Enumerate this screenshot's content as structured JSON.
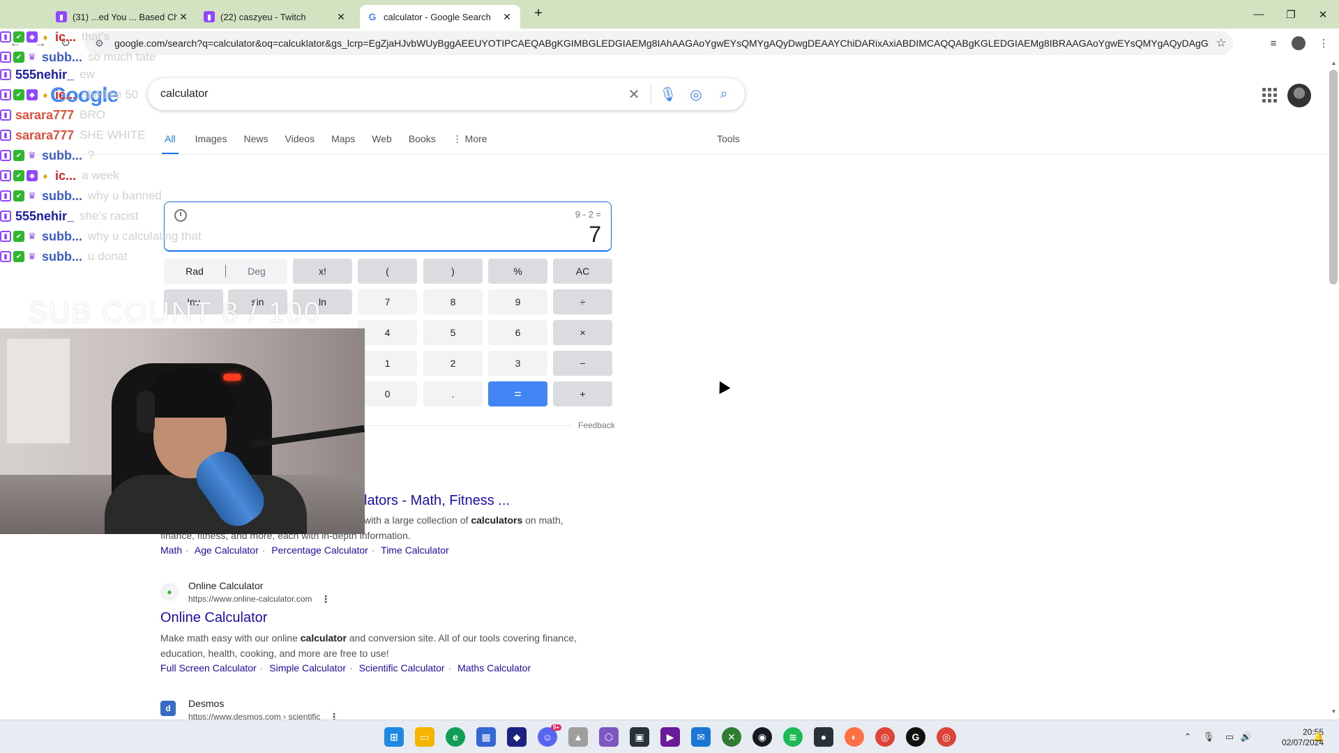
{
  "browser": {
    "tabs": [
      {
        "title": "(31) ...ed You ... Based Ch",
        "favicon": "twitch"
      },
      {
        "title": "(22) caszyeu - Twitch",
        "favicon": "twitch"
      },
      {
        "title": "calculator - Google Search",
        "favicon": "google",
        "active": true
      }
    ],
    "url": "google.com/search?q=calculator&oq=calcuklator&gs_lcrp=EgZjaHJvbWUyBggAEEUYOTIPCAEQABgKGIMBGLEDGIAEMg8IAhAAGAoYgwEYsQMYgAQyDwgDEAAYChiDARixAxiABDIMCAQQABgKGLEDGIAEMg8IBRAAGAoYgwEYsQMYgAQyDAgGEAAYChixAxiAB..."
  },
  "google": {
    "logo": "Google",
    "query": "calculator",
    "tabs": [
      "All",
      "Images",
      "News",
      "Videos",
      "Maps",
      "Web",
      "Books",
      "More"
    ],
    "tools": "Tools"
  },
  "calculator": {
    "expression": "9 - 2 =",
    "result": "7",
    "rad": "Rad",
    "deg": "Deg",
    "keys": {
      "fact": "x!",
      "lparen": "(",
      "rparen": ")",
      "percent": "%",
      "ac": "AC",
      "inv": "Inv",
      "sin": "sin",
      "ln": "ln",
      "k7": "7",
      "k8": "8",
      "k9": "9",
      "div": "÷",
      "k4": "4",
      "k5": "5",
      "k6": "6",
      "mul": "×",
      "k1": "1",
      "k2": "2",
      "k3": "3",
      "sub": "−",
      "k0": "0",
      "dot": ".",
      "eq": "=",
      "add": "+"
    },
    "feedback": "Feedback"
  },
  "results": [
    {
      "title_visible": "lators - Math, Fitness ...",
      "snippet_visible_a": "with a large collection of ",
      "snippet_bold": "calculators",
      "snippet_visible_b": " on math,",
      "snippet_line2": "finance, fitness, and more, each with in-depth information.",
      "sitelinks": [
        "Math",
        "Age Calculator",
        "Percentage Calculator",
        "Time Calculator"
      ]
    },
    {
      "site": "Online Calculator",
      "url": "https://www.online-calculator.com",
      "title": "Online Calculator",
      "snippet_a": "Make math easy with our online ",
      "snippet_bold": "calculator",
      "snippet_b": " and conversion site. All of our tools covering finance,",
      "snippet_line2": "education, health, cooking, and more are free to use!",
      "sitelinks": [
        "Full Screen Calculator",
        "Simple Calculator",
        "Scientific Calculator",
        "Maths Calculator"
      ]
    },
    {
      "site": "Desmos",
      "url": "https://www.desmos.com › scientific"
    }
  ],
  "overlay": {
    "chat": [
      {
        "user": "ic...",
        "color": "#d62222",
        "msg": "that's",
        "badges": [
          "tw",
          "sub",
          "vip",
          "cheer"
        ]
      },
      {
        "user": "subb...",
        "color": "#3c5bc7",
        "msg": "so much tate",
        "badges": [
          "tw",
          "sub",
          "gift"
        ]
      },
      {
        "user": "555nehir_",
        "color": "#1a1aa6",
        "msg": "ew",
        "badges": [
          "tw"
        ]
      },
      {
        "user": "ic...",
        "color": "#d62222",
        "msg": "she like 50",
        "badges": [
          "tw",
          "sub",
          "vip",
          "cheer"
        ]
      },
      {
        "user": "sarara777",
        "color": "#e0503c",
        "msg": "BRO",
        "badges": [
          "tw"
        ]
      },
      {
        "user": "sarara777",
        "color": "#e0503c",
        "msg": "SHE WHITE",
        "badges": [
          "tw"
        ]
      },
      {
        "user": "subb...",
        "color": "#3c5bc7",
        "msg": "?",
        "badges": [
          "tw",
          "sub",
          "gift"
        ]
      },
      {
        "user": "ic...",
        "color": "#d62222",
        "msg": "a week",
        "badges": [
          "tw",
          "sub",
          "vip",
          "cheer"
        ]
      },
      {
        "user": "subb...",
        "color": "#3c5bc7",
        "msg": "why u banned",
        "badges": [
          "tw",
          "sub",
          "gift"
        ]
      },
      {
        "user": "555nehir_",
        "color": "#1a1aa6",
        "msg": "she's racist",
        "badges": [
          "tw"
        ]
      },
      {
        "user": "subb...",
        "color": "#3c5bc7",
        "msg": "why u calculating that",
        "badges": [
          "tw",
          "sub",
          "gift"
        ]
      },
      {
        "user": "subb...",
        "color": "#3c5bc7",
        "msg": "u donat",
        "badges": [
          "tw",
          "sub",
          "gift"
        ]
      }
    ],
    "sub_count": "SUB COUNT 8 / 100"
  },
  "taskbar": {
    "time": "20:55",
    "date": "02/07/2024",
    "discord_badge": "9+"
  }
}
